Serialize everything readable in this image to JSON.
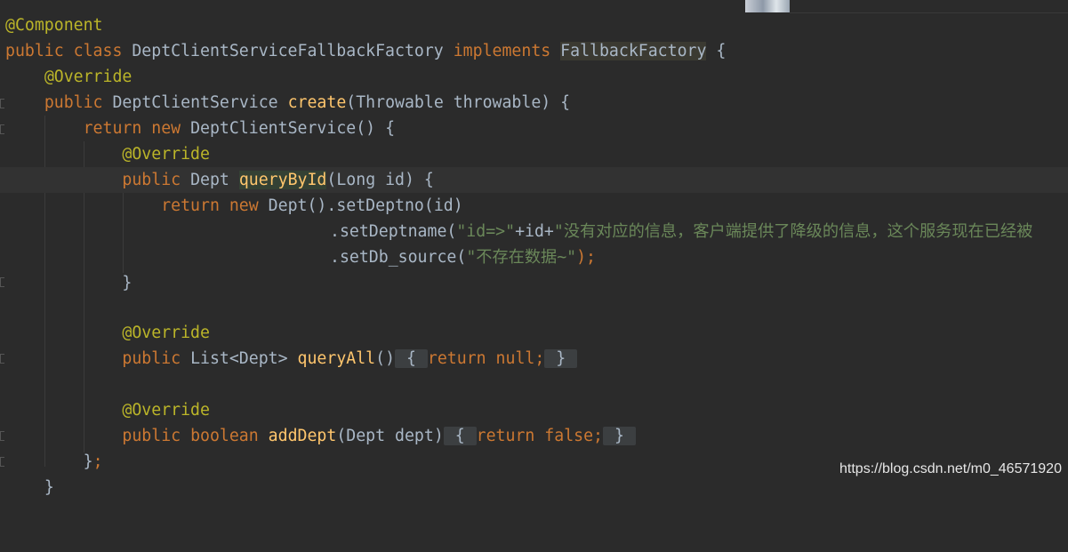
{
  "code": {
    "l1": {
      "annotation": "@Component"
    },
    "l2": {
      "kw_public": "public",
      "kw_class": "class",
      "class_name": "DeptClientServiceFallbackFactory",
      "kw_implements": "implements",
      "interface": "FallbackFactory",
      "brace": "{"
    },
    "l3": {
      "annotation": "@Override"
    },
    "l4": {
      "kw_public": "public",
      "ret_type": "DeptClientService",
      "method": "create",
      "params": "(Throwable throwable) {"
    },
    "l5": {
      "kw_return": "return",
      "kw_new": "new",
      "rest": "DeptClientService() {"
    },
    "l6": {
      "annotation": "@Override"
    },
    "l7": {
      "kw_public": "public",
      "ret_type": "Dept",
      "method": "queryById",
      "params": "(Long id) {"
    },
    "l8": {
      "kw_return": "return",
      "kw_new": "new",
      "rest": "Dept().setDeptno(id)"
    },
    "l9": {
      "call": ".setDeptname(",
      "str1": "\"id=>\"",
      "concat": "+id+",
      "str2": "\"没有对应的信息，客户端提供了降级的信息，这个服务现在已经被"
    },
    "l10": {
      "call": ".setDb_source(",
      "str": "\"不存在数据~\"",
      "end": ");"
    },
    "l11": {
      "brace": "}"
    },
    "l13": {
      "annotation": "@Override"
    },
    "l14": {
      "kw_public": "public",
      "ret_type": "List<Dept>",
      "method": "queryAll",
      "params": "()",
      "fold_open": "{",
      "fold_return": "return",
      "fold_null": "null;",
      "fold_close": "}"
    },
    "l16": {
      "annotation": "@Override"
    },
    "l17": {
      "kw_public": "public",
      "kw_boolean": "boolean",
      "method": "addDept",
      "params": "(Dept dept)",
      "fold_open": "{",
      "fold_return": "return",
      "fold_false": "false;",
      "fold_close": "}"
    },
    "l18": {
      "brace": "}",
      "semi": ";"
    },
    "l19": {
      "brace": "}"
    }
  },
  "watermark": "https://blog.csdn.net/m0_46571920",
  "colors": {
    "background": "#2b2b2b",
    "keyword": "#cc7832",
    "annotation": "#bbb529",
    "method": "#ffc66d",
    "string": "#6a8759",
    "text": "#a9b7c6"
  }
}
